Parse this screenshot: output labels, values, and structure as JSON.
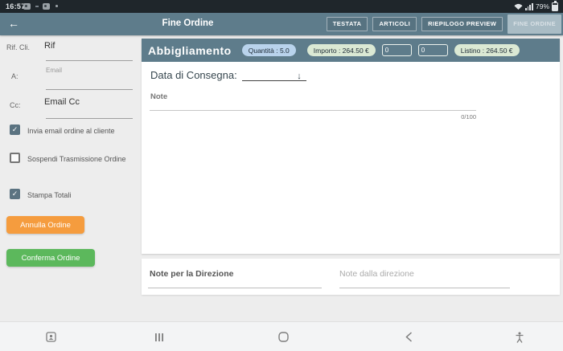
{
  "status_bar": {
    "time": "16:57",
    "battery_percent": "79%"
  },
  "app_bar": {
    "title": "Fine Ordine",
    "back_icon": "←",
    "tabs": [
      {
        "label": "TESTATA",
        "selected": false
      },
      {
        "label": "ARTICOLI",
        "selected": false
      },
      {
        "label": "RIEPILOGO PREVIEW",
        "selected": false
      },
      {
        "label": "FINE ORDINE",
        "selected": true
      }
    ]
  },
  "sidebar": {
    "fields": [
      {
        "label": "Rif. Cli.",
        "value": "Rif"
      },
      {
        "label": "A:",
        "placeholder": "Email"
      },
      {
        "label": "Cc:",
        "value": "Email Cc"
      }
    ],
    "checkboxes": [
      {
        "label": "Invia email ordine al cliente",
        "checked": true
      },
      {
        "label": "Sospendi Trasmissione Ordine",
        "checked": false
      },
      {
        "label": "Stampa Totali",
        "checked": true
      }
    ],
    "check_glyph": "✓",
    "cancel_button": "Annulla Ordine",
    "confirm_button": "Conferma Ordine"
  },
  "main": {
    "category": "Abbigliamento",
    "badges": {
      "quantity": "Quantità : 5.0",
      "amount": "Importo : 264.50 €",
      "box1": "0",
      "box2": "0",
      "list_price": "Listino : 264.50 €"
    },
    "delivery_label": "Data di Consegna:",
    "delivery_arrow": "↓",
    "note_label": "Note",
    "note_counter": "0/100"
  },
  "notes_section": {
    "direction_to": "Note per la Direzione",
    "direction_from": "Note dalla direzione"
  },
  "colors": {
    "app_bar": "#5e7c8b",
    "selected_tab": "#a9bcc5",
    "quantity_pill": "#b9d3ec",
    "price_pill": "#dbe9d4",
    "cancel_button": "#f59c3e",
    "confirm_button": "#5cb85c",
    "checkbox_checked": "#5b7381"
  }
}
